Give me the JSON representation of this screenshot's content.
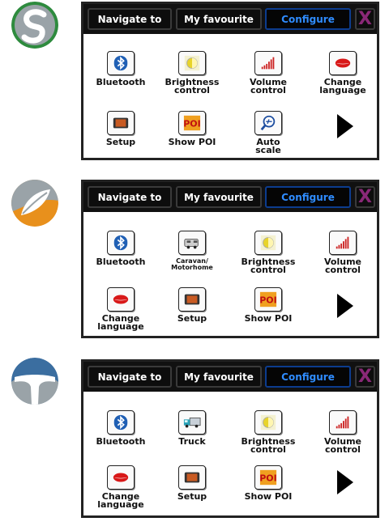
{
  "nav": {
    "navigate_to": "Navigate to",
    "my_favourite": "My favourite",
    "configure": "Configure",
    "close_glyph": "X"
  },
  "colors": {
    "logo1": "#2e8b3e",
    "logo2": "#e8901c",
    "logo3": "#3b6ea0",
    "active_tab_text": "#2f8cff",
    "close_x": "#8a2877"
  },
  "screens": [
    {
      "logo_icon": "green-s-logo",
      "items": [
        {
          "label": "Bluetooth",
          "icon": "bluetooth-icon"
        },
        {
          "label": "Brightness\ncontrol",
          "icon": "brightness-icon"
        },
        {
          "label": "Volume\ncontrol",
          "icon": "volume-icon"
        },
        {
          "label": "Change\nlanguage",
          "icon": "lips-icon"
        },
        {
          "label": "Setup",
          "icon": "setup-icon"
        },
        {
          "label": "Show POI",
          "icon": "poi-icon"
        },
        {
          "label": "Auto\nscale",
          "icon": "auto-scale-icon"
        }
      ]
    },
    {
      "logo_icon": "orange-leaf-logo",
      "items": [
        {
          "label": "Bluetooth",
          "icon": "bluetooth-icon"
        },
        {
          "label": "Caravan/\nMotorhome",
          "icon": "caravan-icon"
        },
        {
          "label": "Brightness\ncontrol",
          "icon": "brightness-icon"
        },
        {
          "label": "Volume\ncontrol",
          "icon": "volume-icon"
        },
        {
          "label": "Change\nlanguage",
          "icon": "lips-icon"
        },
        {
          "label": "Setup",
          "icon": "setup-icon"
        },
        {
          "label": "Show POI",
          "icon": "poi-icon"
        }
      ]
    },
    {
      "logo_icon": "blue-road-logo",
      "items": [
        {
          "label": "Bluetooth",
          "icon": "bluetooth-icon"
        },
        {
          "label": "Truck",
          "icon": "truck-icon"
        },
        {
          "label": "Brightness\ncontrol",
          "icon": "brightness-icon"
        },
        {
          "label": "Volume\ncontrol",
          "icon": "volume-icon"
        },
        {
          "label": "Change\nlanguage",
          "icon": "lips-icon"
        },
        {
          "label": "Setup",
          "icon": "setup-icon"
        },
        {
          "label": "Show POI",
          "icon": "poi-icon"
        }
      ]
    }
  ]
}
